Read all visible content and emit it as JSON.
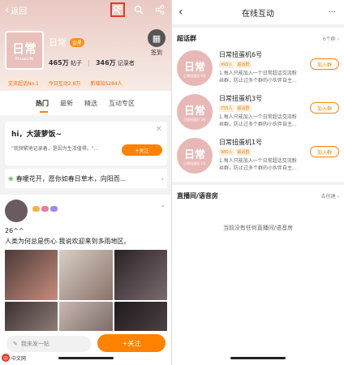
{
  "left": {
    "back_label": "返回",
    "group_name": "日常",
    "level_badge": "金星",
    "avatar_big": "日常",
    "avatar_small": "ShuaiLife",
    "posts_count": "465万",
    "posts_label": "帖子",
    "members_count": "346万",
    "members_label": "记录者",
    "signin_label": "签到",
    "pills": [
      "交流超话No.1",
      "今日互动2.8万",
      "新增加5284人"
    ],
    "tabs": [
      "热门",
      "最新",
      "精选",
      "互动专区"
    ],
    "greet_title": "hi，大菠萝饭~",
    "greet_desc": "\"我频繁地记录着，是因为生活值得。\"...",
    "greet_follow": "+关注",
    "marquee": "春暖花开，愿你如春日草木，向阳而...",
    "post_text1": "26^^",
    "post_text2": "人类为何总是伤心 我说欢迎来到多雨地区。",
    "compose_placeholder": "我来发一帖",
    "bottom_follow": "+关注",
    "watermark": "中文网"
  },
  "right": {
    "title": "在线互动",
    "more": "···",
    "chat_section": "超话群",
    "chat_count": "6个群",
    "groups": [
      {
        "name": "日常扭蛋机6号",
        "count": "993人",
        "tag": "超话群",
        "desc": "1.每人只能加入一个日常超话交流粉丝群，防止过多个群的小伙伴自主...",
        "join": "加入群",
        "avatar_big": "日常",
        "avatar_small": "日常扭蛋机 6号"
      },
      {
        "name": "日常扭蛋机3号",
        "count": "755人",
        "tag": "超话群",
        "desc": "1.每人只能加入一个日常超话交流粉丝群，防止过多个群的小伙伴自主...",
        "join": "加入群",
        "avatar_big": "日常",
        "avatar_small": "日常扭蛋机 3号"
      },
      {
        "name": "日常扭蛋机1号",
        "count": "980人",
        "tag": "超话群",
        "desc": "1.每人只能加入一个日常超话交流粉丝群，防止过多个群的小伙伴自主...",
        "join": "加入群",
        "avatar_big": "日常",
        "avatar_small": "日常扭蛋机 1号"
      }
    ],
    "live_section": "直播间/语音房",
    "live_create": "去创建",
    "live_empty": "当前没有任何直播间/语音房"
  }
}
